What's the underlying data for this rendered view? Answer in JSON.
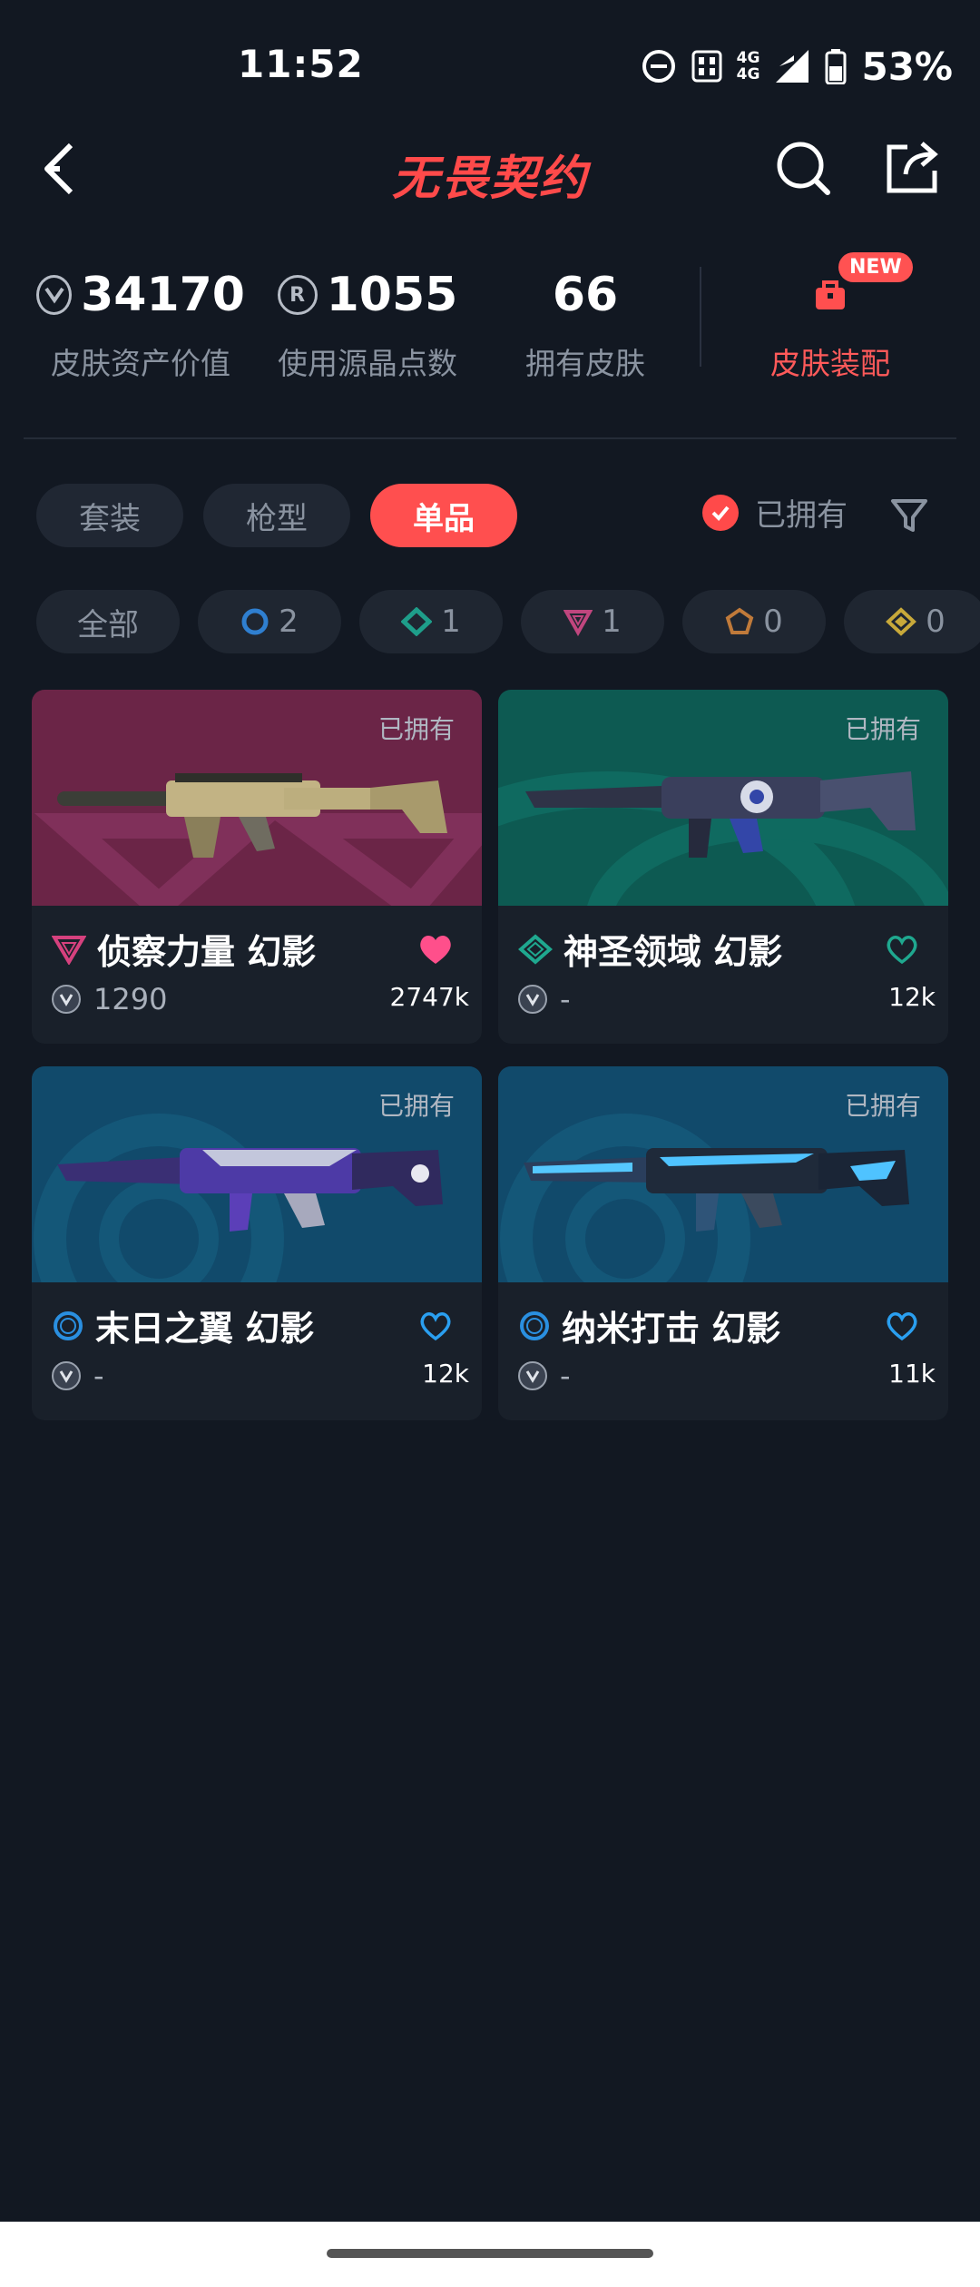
{
  "status_bar": {
    "time": "11:52",
    "network_top": "4G",
    "network_bottom": "4G",
    "battery": "53%"
  },
  "header": {
    "title": "无畏契约",
    "icons": [
      "back-icon",
      "search-icon",
      "share-icon"
    ]
  },
  "stats": [
    {
      "value": "34170",
      "label": "皮肤资产价值",
      "icon": "valorant-point-icon"
    },
    {
      "value": "1055",
      "label": "使用源晶点数",
      "icon": "radianite-icon"
    },
    {
      "value": "66",
      "label": "拥有皮肤"
    },
    {
      "label": "皮肤装配",
      "badge": "NEW",
      "icon": "wardrobe-icon"
    }
  ],
  "tabs": [
    {
      "label": "套装",
      "active": false
    },
    {
      "label": "枪型",
      "active": false
    },
    {
      "label": "单品",
      "active": true
    }
  ],
  "owned_toggle": {
    "label": "已拥有",
    "checked": true
  },
  "rarity_filters": [
    {
      "label": "全部"
    },
    {
      "count": "2",
      "icon": "select-tier-icon",
      "color": "#2f7fd0"
    },
    {
      "count": "1",
      "icon": "deluxe-tier-icon",
      "color": "#1e9e8a"
    },
    {
      "count": "1",
      "icon": "premium-tier-icon",
      "color": "#c0467e"
    },
    {
      "count": "0",
      "icon": "exclusive-tier-icon",
      "color": "#c07a3a"
    },
    {
      "count": "0",
      "icon": "ultra-tier-icon",
      "color": "#c8a93a"
    }
  ],
  "items": [
    {
      "name": "侦察力量 幻影",
      "owned": "已拥有",
      "price": "1290",
      "likes": "2747k",
      "tier_color": "#d6417e",
      "liked": true,
      "bg": "#6b2547"
    },
    {
      "name": "神圣领域 幻影",
      "owned": "已拥有",
      "price": "-",
      "likes": "12k",
      "tier_color": "#1fa88f",
      "liked": false,
      "bg": "#0d5a52"
    },
    {
      "name": "末日之翼 幻影",
      "owned": "已拥有",
      "price": "-",
      "likes": "12k",
      "tier_color": "#2a8fe0",
      "liked": false,
      "bg": "#114a6b"
    },
    {
      "name": "纳米打击 幻影",
      "owned": "已拥有",
      "price": "-",
      "likes": "11k",
      "tier_color": "#2a8fe0",
      "liked": false,
      "bg": "#114a6b"
    }
  ]
}
